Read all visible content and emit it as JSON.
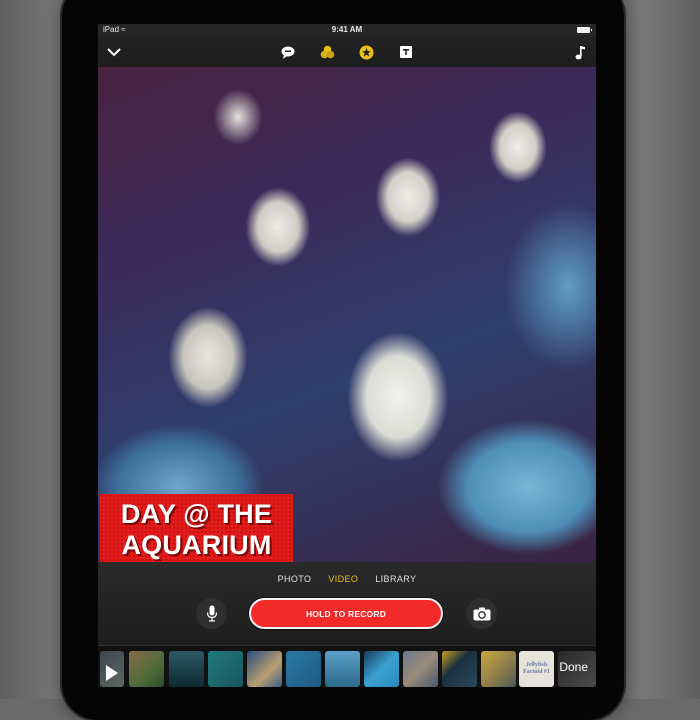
{
  "status_bar": {
    "device": "iPad",
    "time": "9:41 AM"
  },
  "toolbar": {
    "icons": [
      "chevron-down-icon",
      "speech-bubble-icon",
      "filters-icon",
      "star-sticker-icon",
      "text-icon",
      "music-note-icon"
    ],
    "accent_color": "#e8c01f"
  },
  "photo": {
    "title_card": {
      "line1": "DAY @ THE",
      "line2": "AQUARIUM",
      "color": "#e41b1b"
    }
  },
  "capture": {
    "modes": [
      "PHOTO",
      "VIDEO",
      "LIBRARY"
    ],
    "active_mode": "VIDEO",
    "record_label": "HOLD TO RECORD",
    "record_color": "#f22a2a"
  },
  "film_strip": {
    "clips": [
      {
        "name": "clip-garden"
      },
      {
        "name": "clip-aquarium-tank-silhouettes"
      },
      {
        "name": "clip-teal-water"
      },
      {
        "name": "clip-seahorse"
      },
      {
        "name": "clip-blue-fish"
      },
      {
        "name": "clip-reef"
      },
      {
        "name": "clip-whale-shark"
      },
      {
        "name": "clip-coral"
      },
      {
        "name": "clip-yellow-fish"
      },
      {
        "name": "clip-yellow-texture"
      },
      {
        "name": "clip-title-card",
        "text_line1": "Jellyfish",
        "text_line2": "Factoid #1"
      }
    ],
    "done_label": "Done"
  }
}
